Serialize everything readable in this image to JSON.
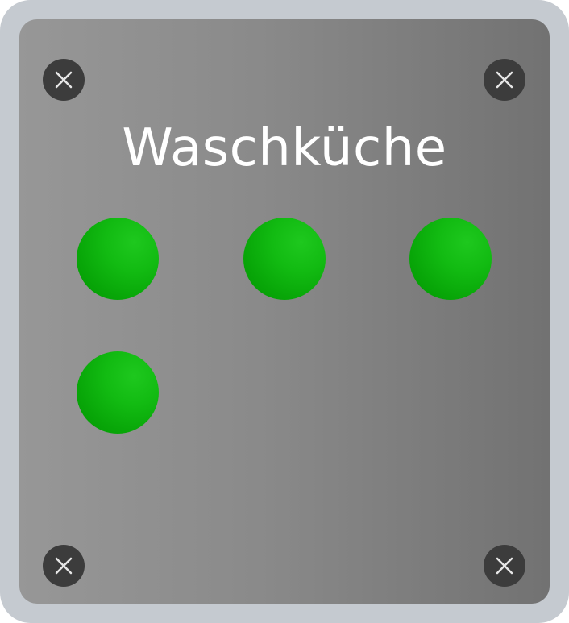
{
  "panel": {
    "title": "Waschküche",
    "frame_color": "#c5cad0",
    "plate_gradient": [
      "#979797",
      "#727272"
    ],
    "screw_color": "#3c3c3c",
    "screw_icon": "x-mark-icon"
  },
  "indicators": [
    {
      "name": "indicator-1",
      "state": "on",
      "color": "#12bb12"
    },
    {
      "name": "indicator-2",
      "state": "on",
      "color": "#12bb12"
    },
    {
      "name": "indicator-3",
      "state": "on",
      "color": "#12bb12"
    },
    {
      "name": "indicator-4",
      "state": "on",
      "color": "#12bb12"
    }
  ]
}
